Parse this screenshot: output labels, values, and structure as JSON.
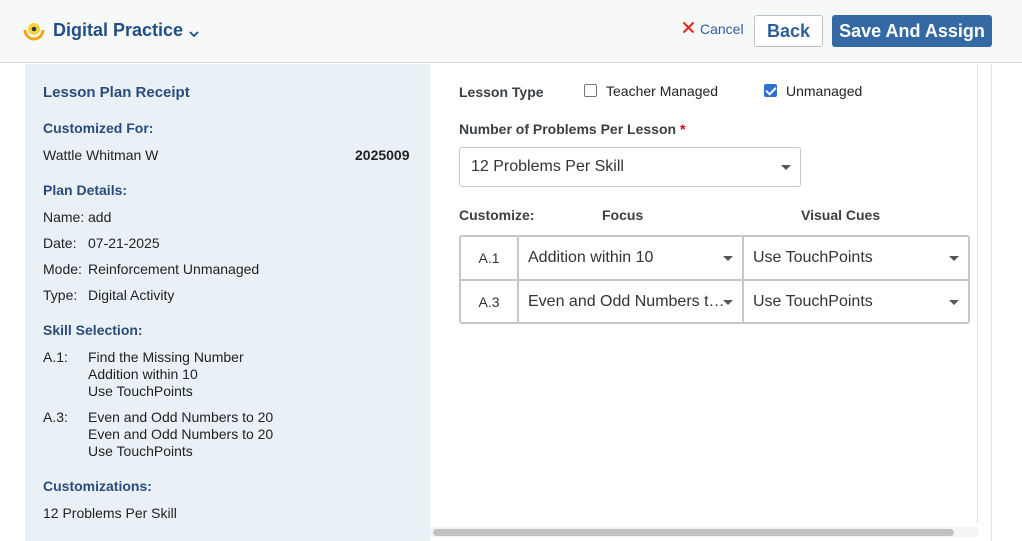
{
  "header": {
    "app_title": "Digital Practice",
    "cancel_label": "Cancel",
    "back_label": "Back",
    "save_label": "Save And Assign",
    "colors": {
      "brand": "#1f4f86",
      "primary_button": "#336aa3",
      "cancel_icon": "#e0281f"
    }
  },
  "receipt": {
    "title": "Lesson Plan Receipt",
    "customized_for_heading": "Customized For:",
    "student_name": "Wattle Whitman W",
    "student_id": "2025009",
    "plan_details_heading": "Plan Details:",
    "name_label": "Name:",
    "name_value": "add",
    "date_label": "Date:",
    "date_value": "07-21-2025",
    "mode_label": "Mode:",
    "mode_value": "Reinforcement Unmanaged",
    "type_label": "Type:",
    "type_value": "Digital Activity",
    "skill_heading": "Skill Selection:",
    "skills": [
      {
        "code": "A.1:",
        "lines": [
          "Find the Missing Number",
          "Addition within 10",
          "Use TouchPoints"
        ]
      },
      {
        "code": "A.3:",
        "lines": [
          "Even and Odd Numbers to 20",
          "Even and Odd Numbers to 20",
          "Use TouchPoints"
        ]
      }
    ],
    "customizations_heading": "Customizations:",
    "customizations_value": "12 Problems Per Skill"
  },
  "form": {
    "lesson_type_label": "Lesson Type",
    "teacher_managed_label": "Teacher Managed",
    "teacher_managed_checked": false,
    "unmanaged_label": "Unmanaged",
    "unmanaged_checked": true,
    "problems_label": "Number of Problems Per Lesson",
    "required_marker": "*",
    "problems_value": "12 Problems Per Skill",
    "customize_label": "Customize:",
    "focus_label": "Focus",
    "visual_cues_label": "Visual Cues",
    "rows": [
      {
        "code": "A.1",
        "focus": "Addition within 10",
        "visual_cues": "Use TouchPoints"
      },
      {
        "code": "A.3",
        "focus": "Even and Odd Numbers t…",
        "visual_cues": "Use TouchPoints"
      }
    ]
  },
  "icons": {
    "brand_logo": "digital-practice-logo-icon",
    "brand_dropdown": "chevron-down-icon",
    "cancel": "close-x-icon",
    "select_caret": "caret-down-icon",
    "checkbox_checked": "checkmark-icon"
  }
}
